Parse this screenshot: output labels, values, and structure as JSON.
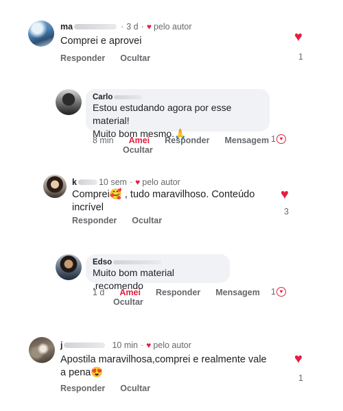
{
  "comments": [
    {
      "author": "ma",
      "time": "3 d",
      "badge": "pelo autor",
      "text": "Comprei e aprovei",
      "actions": {
        "reply": "Responder",
        "hide": "Ocultar"
      },
      "likes": "1"
    },
    {
      "author": "Carlo",
      "text_line1": "Estou estudando agora por esse material!",
      "text_line2": "Muito bom mesmo.🙏",
      "time": "8 min",
      "actions": {
        "like": "Amei",
        "reply": "Responder",
        "message": "Mensagem",
        "hide": "Ocultar"
      },
      "likes": "1"
    },
    {
      "author": "k",
      "time": "10 sem",
      "badge": "pelo autor",
      "text_line1": "Comprei🥰 , tudo maravilhoso. Conteúdo",
      "text_line2": "incrível",
      "actions": {
        "reply": "Responder",
        "hide": "Ocultar"
      },
      "likes": "3"
    },
    {
      "author": "Edso",
      "text": "Muito bom material ,recomendo",
      "time": "1 d",
      "actions": {
        "like": "Amei",
        "reply": "Responder",
        "message": "Mensagem",
        "hide": "Ocultar"
      },
      "likes": "1"
    },
    {
      "author": "j",
      "time": "10 min",
      "badge": "pelo autor",
      "text_line1": "Apostila maravilhosa,comprei e realmente vale",
      "text_line2": "a pena😍",
      "actions": {
        "reply": "Responder",
        "hide": "Ocultar"
      },
      "likes": "1"
    }
  ],
  "colors": {
    "accent": "#e41e3f",
    "muted": "#65676b",
    "bubble": "#f0f2f5"
  },
  "icons": {
    "reaction": "heart-icon"
  }
}
